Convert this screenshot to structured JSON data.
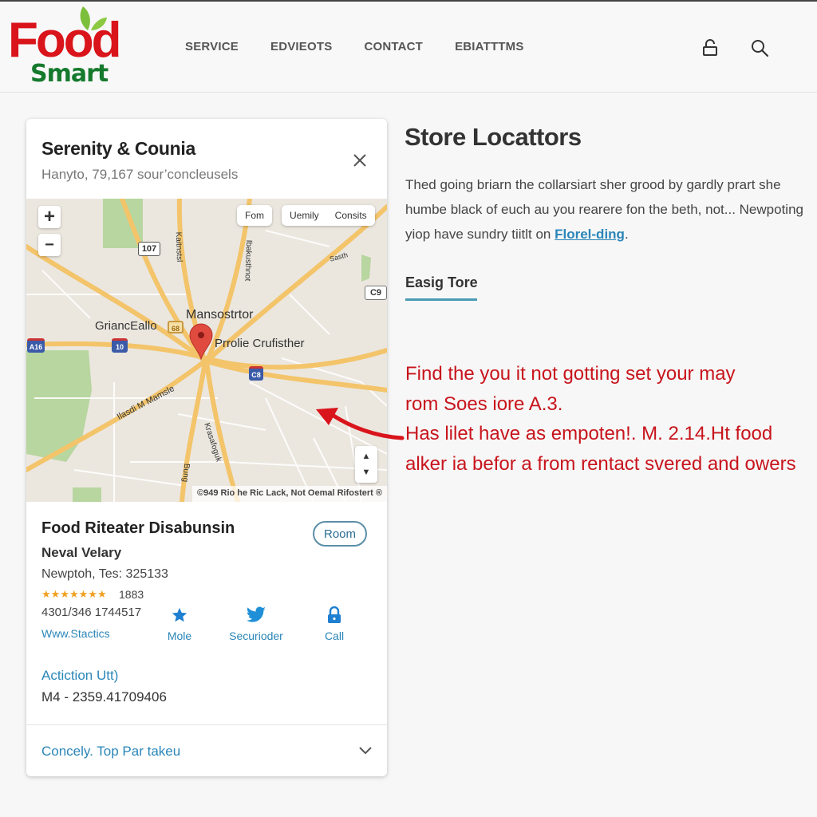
{
  "brand": {
    "line1": "Food",
    "line2": "Smart",
    "colors": {
      "red": "#d9141b",
      "green": "#167a2d",
      "leaf": "#7cbf3a"
    }
  },
  "nav": {
    "items": [
      {
        "label": "SERVICE"
      },
      {
        "label": "EDVIEOTS"
      },
      {
        "label": "CONTACT"
      },
      {
        "label": "EBIATTTMS"
      }
    ],
    "icons": [
      "lock-icon",
      "search-icon"
    ]
  },
  "card": {
    "title": "Serenity & Counia",
    "subtitle": "Hanyto, 79,167 sour’concleusels",
    "close_icon": "close-icon",
    "map": {
      "zoom_in": "+",
      "zoom_out": "−",
      "pill_single": "Fom",
      "pill_group": [
        "Uemily",
        "Consits"
      ],
      "labels": {
        "city_main": "Mansostrtor",
        "city_left": "GriancEallo",
        "place": "Prrolie Crufisther",
        "road_vertical_1": "Kaitnstsl",
        "road_vertical_2": "Ibakusthnot",
        "road_diag": "Ilasdi M Mamsle",
        "road_lower": "Krasafoguk",
        "road_lower_2": "Bung",
        "road_east": "Sasth"
      },
      "shields": {
        "route_107": "107",
        "interstate_left": "A16",
        "interstate_mid": "10",
        "interstate_right": "C8",
        "state_badge": "68",
        "right_edge": "C9"
      },
      "attribution": "©949 Rio he Ric Lack, Not Oemal Rifostert ®",
      "pan_up": "▲",
      "pan_down": "▼"
    },
    "details": {
      "name": "Food Riteater Disabunsin",
      "subname": "Neval Velary",
      "address": "Newptoh, Tes: 325133",
      "rating_stars": 7,
      "rating_count": "1883",
      "phone": "4301/346 1744517",
      "website": "Www.Stactics",
      "room_button": "Room",
      "actions": [
        {
          "label": "Mole",
          "icon": "star-icon"
        },
        {
          "label": "Securioder",
          "icon": "bird-icon"
        },
        {
          "label": "Call",
          "icon": "lock-icon"
        }
      ],
      "section_label": "Actiction Utt)",
      "code": "M4 - 2359.41709406"
    },
    "footer": {
      "label": "Concely. Top Par takeu",
      "icon": "chevron-down-icon"
    }
  },
  "right": {
    "title": "Store Locattors",
    "paragraph_lines": [
      "Thed going briarn the collarsiart sher grood by gardly prart she",
      "humbe black of euch au you rearere fon the beth, not... Newpoting",
      "yiop have sundry tiitlt on "
    ],
    "paragraph_link": "Florel-ding",
    "paragraph_end": ".",
    "tab_label": "Easig Tore",
    "red_note_lines": [
      "Find the you it not gotting set your may",
      "rom Soes iore A.3.",
      "Has lilet have as empoten!. M. 2.14.Ht food",
      "alker ia befor a from rentact svered and owers"
    ],
    "colors": {
      "note": "#c8141c",
      "link": "#2a86b8",
      "accent": "#4a9bb5"
    }
  }
}
